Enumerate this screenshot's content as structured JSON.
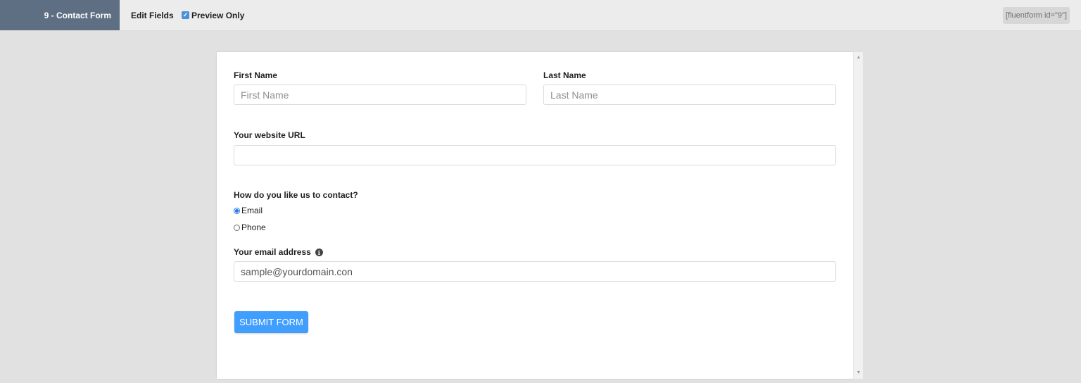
{
  "topbar": {
    "form_tag": "9 - Contact Form",
    "edit_fields": "Edit Fields",
    "preview_only": "Preview Only",
    "preview_checked": true,
    "shortcode": "[fluentform id=\"9\"]"
  },
  "form": {
    "first_name": {
      "label": "First Name",
      "placeholder": "First Name",
      "value": ""
    },
    "last_name": {
      "label": "Last Name",
      "placeholder": "Last Name",
      "value": ""
    },
    "website": {
      "label": "Your website URL",
      "placeholder": "",
      "value": ""
    },
    "contact": {
      "label": "How do you like us to contact?",
      "options": [
        {
          "label": "Email",
          "selected": true
        },
        {
          "label": "Phone",
          "selected": false
        }
      ]
    },
    "email": {
      "label": "Your email address",
      "placeholder": "",
      "value": "sample@yourdomain.con"
    },
    "submit_label": "SUBMIT FORM"
  },
  "colors": {
    "accent": "#409eff",
    "form_tag_bg": "#5f6f83",
    "page_bg": "#e1e1e1"
  }
}
